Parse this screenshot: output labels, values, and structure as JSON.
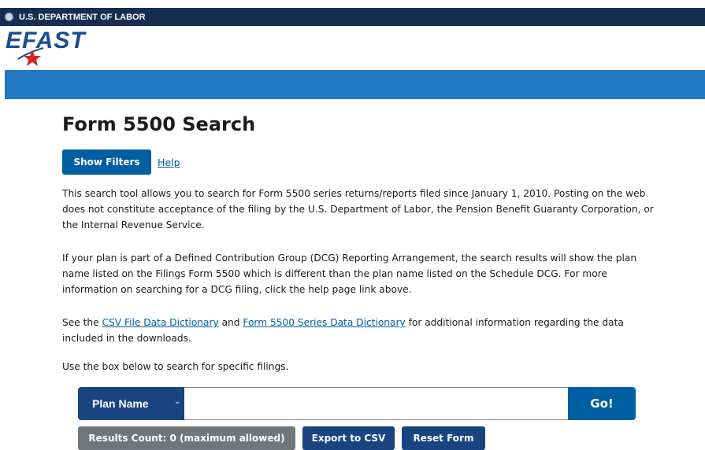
{
  "gov_banner": {
    "text": "U.S. DEPARTMENT OF LABOR"
  },
  "logo": {
    "text": "EFAST"
  },
  "page_title": "Form 5500 Search",
  "filters": {
    "show_filters_label": "Show Filters",
    "help_label": "Help"
  },
  "intro": {
    "p1": "This search tool allows you to search for Form 5500 series returns/reports filed since January 1, 2010. Posting on the web does not constitute acceptance of the filing by the U.S. Department of Labor, the Pension Benefit Guaranty Corporation, or the Internal Revenue Service.",
    "p2": "If your plan is part of a Defined Contribution Group (DCG) Reporting Arrangement, the search results will show the plan name listed on the Filings Form 5500 which is different than the plan name listed on the Schedule DCG. For more information on searching for a DCG filing, click the help page link above.",
    "p3_prefix": "See the ",
    "csv_dictionary_link": "CSV File Data Dictionary",
    "p3_and": " and ",
    "series_dictionary_link": "Form 5500 Series Data Dictionary",
    "p3_suffix": " for additional information regarding the data included in the downloads.",
    "p4": "Use the box below to search for specific filings."
  },
  "search": {
    "field_select": "Plan Name",
    "input_value": "",
    "input_placeholder": "",
    "go_label": "Go!"
  },
  "actions": {
    "results_count": "Results Count:  0 (maximum allowed)",
    "export_label": "Export to CSV",
    "reset_label": "Reset Form"
  },
  "colors": {
    "banner": "#162e51",
    "band": "#2378c3",
    "primary": "#005ea2",
    "dark_primary": "#1a4480",
    "disabled": "#71767a"
  }
}
